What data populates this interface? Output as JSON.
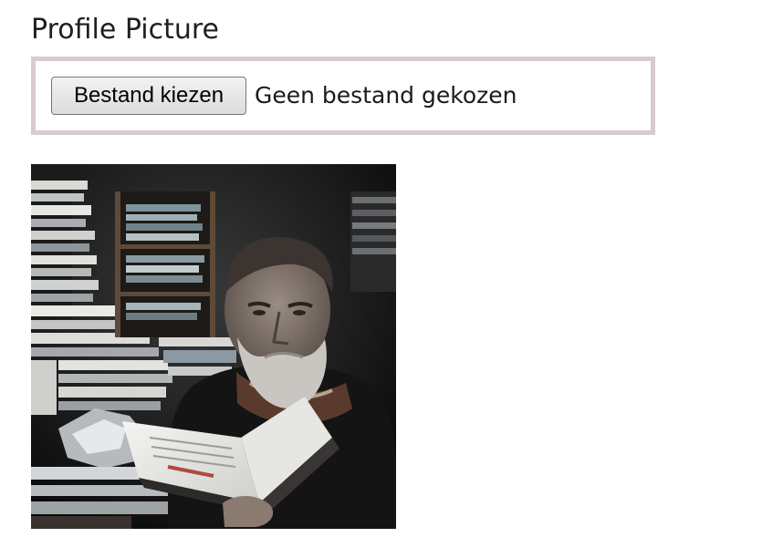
{
  "profile_picture": {
    "title": "Profile Picture",
    "choose_button_label": "Bestand kiezen",
    "file_status": "Geen bestand gekozen"
  },
  "photo": {
    "subject": "older man with gray beard reading a book among stacks of books",
    "icon": "profile-photo"
  },
  "colors": {
    "box_border": "#d8cbcb",
    "button_top": "#f2f2f2",
    "button_bottom": "#dcdcdc",
    "text": "#1f1f1f"
  }
}
